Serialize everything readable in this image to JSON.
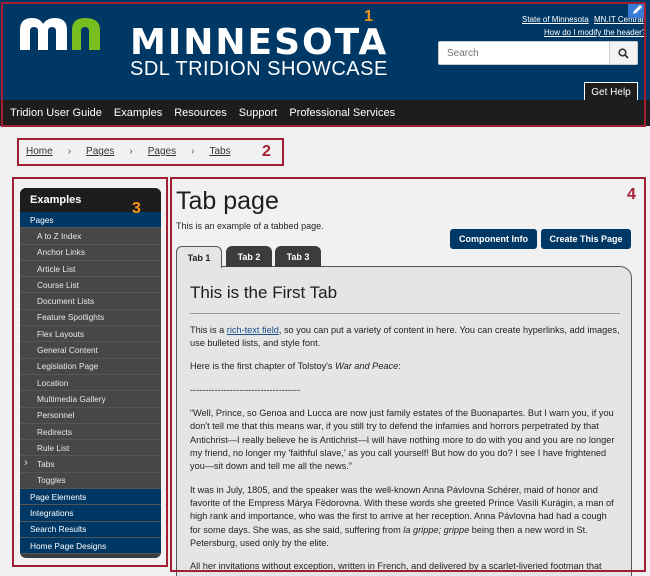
{
  "header": {
    "logo_word": "MINNESOTA",
    "logo_sub": "SDL TRIDION SHOWCASE",
    "link_state": "State of Minnesota",
    "link_mnit": "MN.IT Central",
    "link_modify": "How do I modify the header?",
    "search_placeholder": "Search",
    "get_help": "Get Help",
    "brand_blue": "#003865",
    "brand_green": "#78be20"
  },
  "nav": {
    "items": [
      "Tridion User Guide",
      "Examples",
      "Resources",
      "Support",
      "Professional Services"
    ]
  },
  "breadcrumb": [
    "Home",
    "Pages",
    "Pages",
    "Tabs"
  ],
  "annotations": [
    "1",
    "2",
    "3",
    "4"
  ],
  "sidebar": {
    "title": "Examples",
    "top_item": "Pages",
    "sub_items": [
      "A to Z Index",
      "Anchor Links",
      "Article List",
      "Course List",
      "Document Lists",
      "Feature Spotlights",
      "Flex Layouts",
      "General Content",
      "Legislation Page",
      "Location",
      "Multimedia Gallery",
      "Personnel",
      "Redirects",
      "Rule List",
      "Tabs",
      "Toggles"
    ],
    "bottom_items": [
      "Page Elements",
      "Integrations",
      "Search Results",
      "Home Page Designs"
    ]
  },
  "main": {
    "title": "Tab page",
    "intro": "This is an example of a tabbed page.",
    "btn_component": "Component Info",
    "btn_create": "Create This Page",
    "tabs": [
      "Tab 1",
      "Tab 2",
      "Tab 3"
    ],
    "panel": {
      "heading": "This is the First Tab",
      "p1_pre": "This is a ",
      "p1_link": "rich-text field",
      "p1_post": ", so you can put a variety of content in here. You can create hyperlinks, add images, use bulleted lists, and style font.",
      "p2_pre": "Here is the first chapter of Tolstoy's ",
      "p2_em": "War and Peace",
      "p2_post": ":",
      "divider": "------------------------------------",
      "p3": "“Well, Prince, so Genoa and Lucca are now just family estates of the Buonapartes. But I warn you, if you don't tell me that this means war, if you still try to defend the infamies and horrors perpetrated by that Antichrist—I really believe he is Antichrist—I will have nothing more to do with you and you are no longer my friend, no longer my 'faithful slave,' as you call yourself! But how do you do? I see I have frightened you—sit down and tell me all the news.”",
      "p4_pre": "It was in July, 1805, and the speaker was the well-known Anna Pávlovna Schérer, maid of honor and favorite of the Empress Márya Fëdorovna. With these words she greeted Prince Vasíli Kurágin, a man of high rank and importance, who was the first to arrive at her reception. Anna Pávlovna had had a cough for some days. She was, as she said, suffering from ",
      "p4_em": "la grippe; grippe",
      "p4_post": " being then a new word in St. Petersburg, used only by the elite.",
      "p5": "All her invitations without exception, written in French, and delivered by a scarlet-liveried footman that morning, ran as follows:"
    }
  }
}
